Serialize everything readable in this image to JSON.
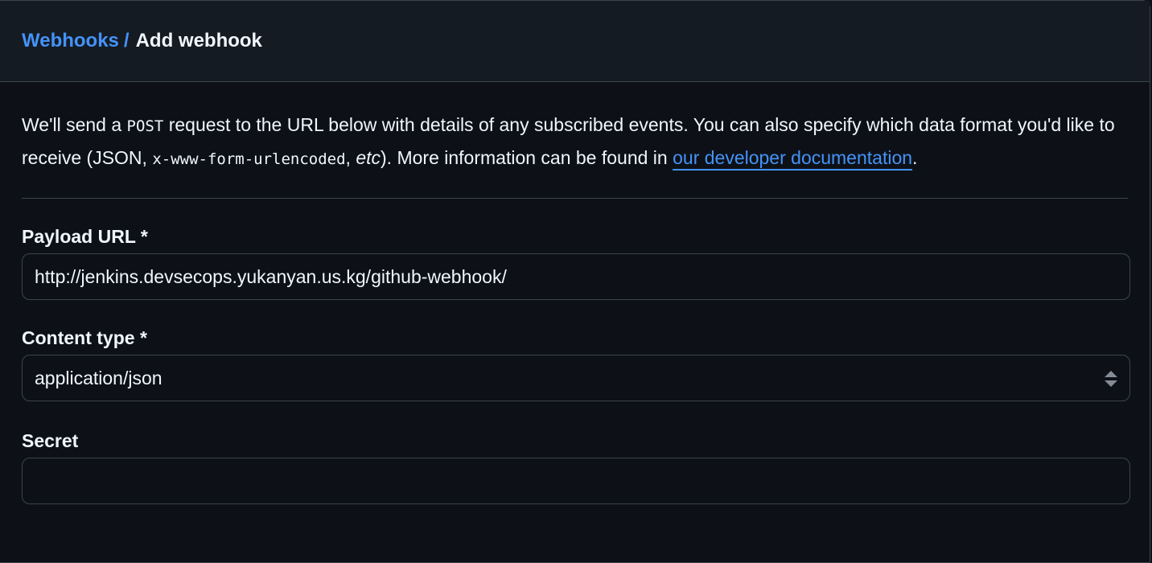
{
  "breadcrumb": {
    "parent": "Webhooks",
    "separator": "/",
    "current": "Add webhook"
  },
  "intro": {
    "p1": "We'll send a ",
    "code1": "POST",
    "p2": " request to the URL below with details of any subscribed events. You can also specify which data format you'd like to receive (JSON, ",
    "code2": "x-www-form-urlencoded",
    "p3": ", ",
    "em": "etc",
    "p4": "). More information can be found in ",
    "link": "our developer documentation",
    "p5": "."
  },
  "form": {
    "payload_url": {
      "label": "Payload URL *",
      "value": "http://jenkins.devsecops.yukanyan.us.kg/github-webhook/"
    },
    "content_type": {
      "label": "Content type *",
      "value": "application/json"
    },
    "secret": {
      "label": "Secret",
      "value": ""
    }
  },
  "colors": {
    "accent": "#4493f8",
    "background": "#0d1117",
    "header": "#151b23",
    "border": "#3d444d"
  }
}
